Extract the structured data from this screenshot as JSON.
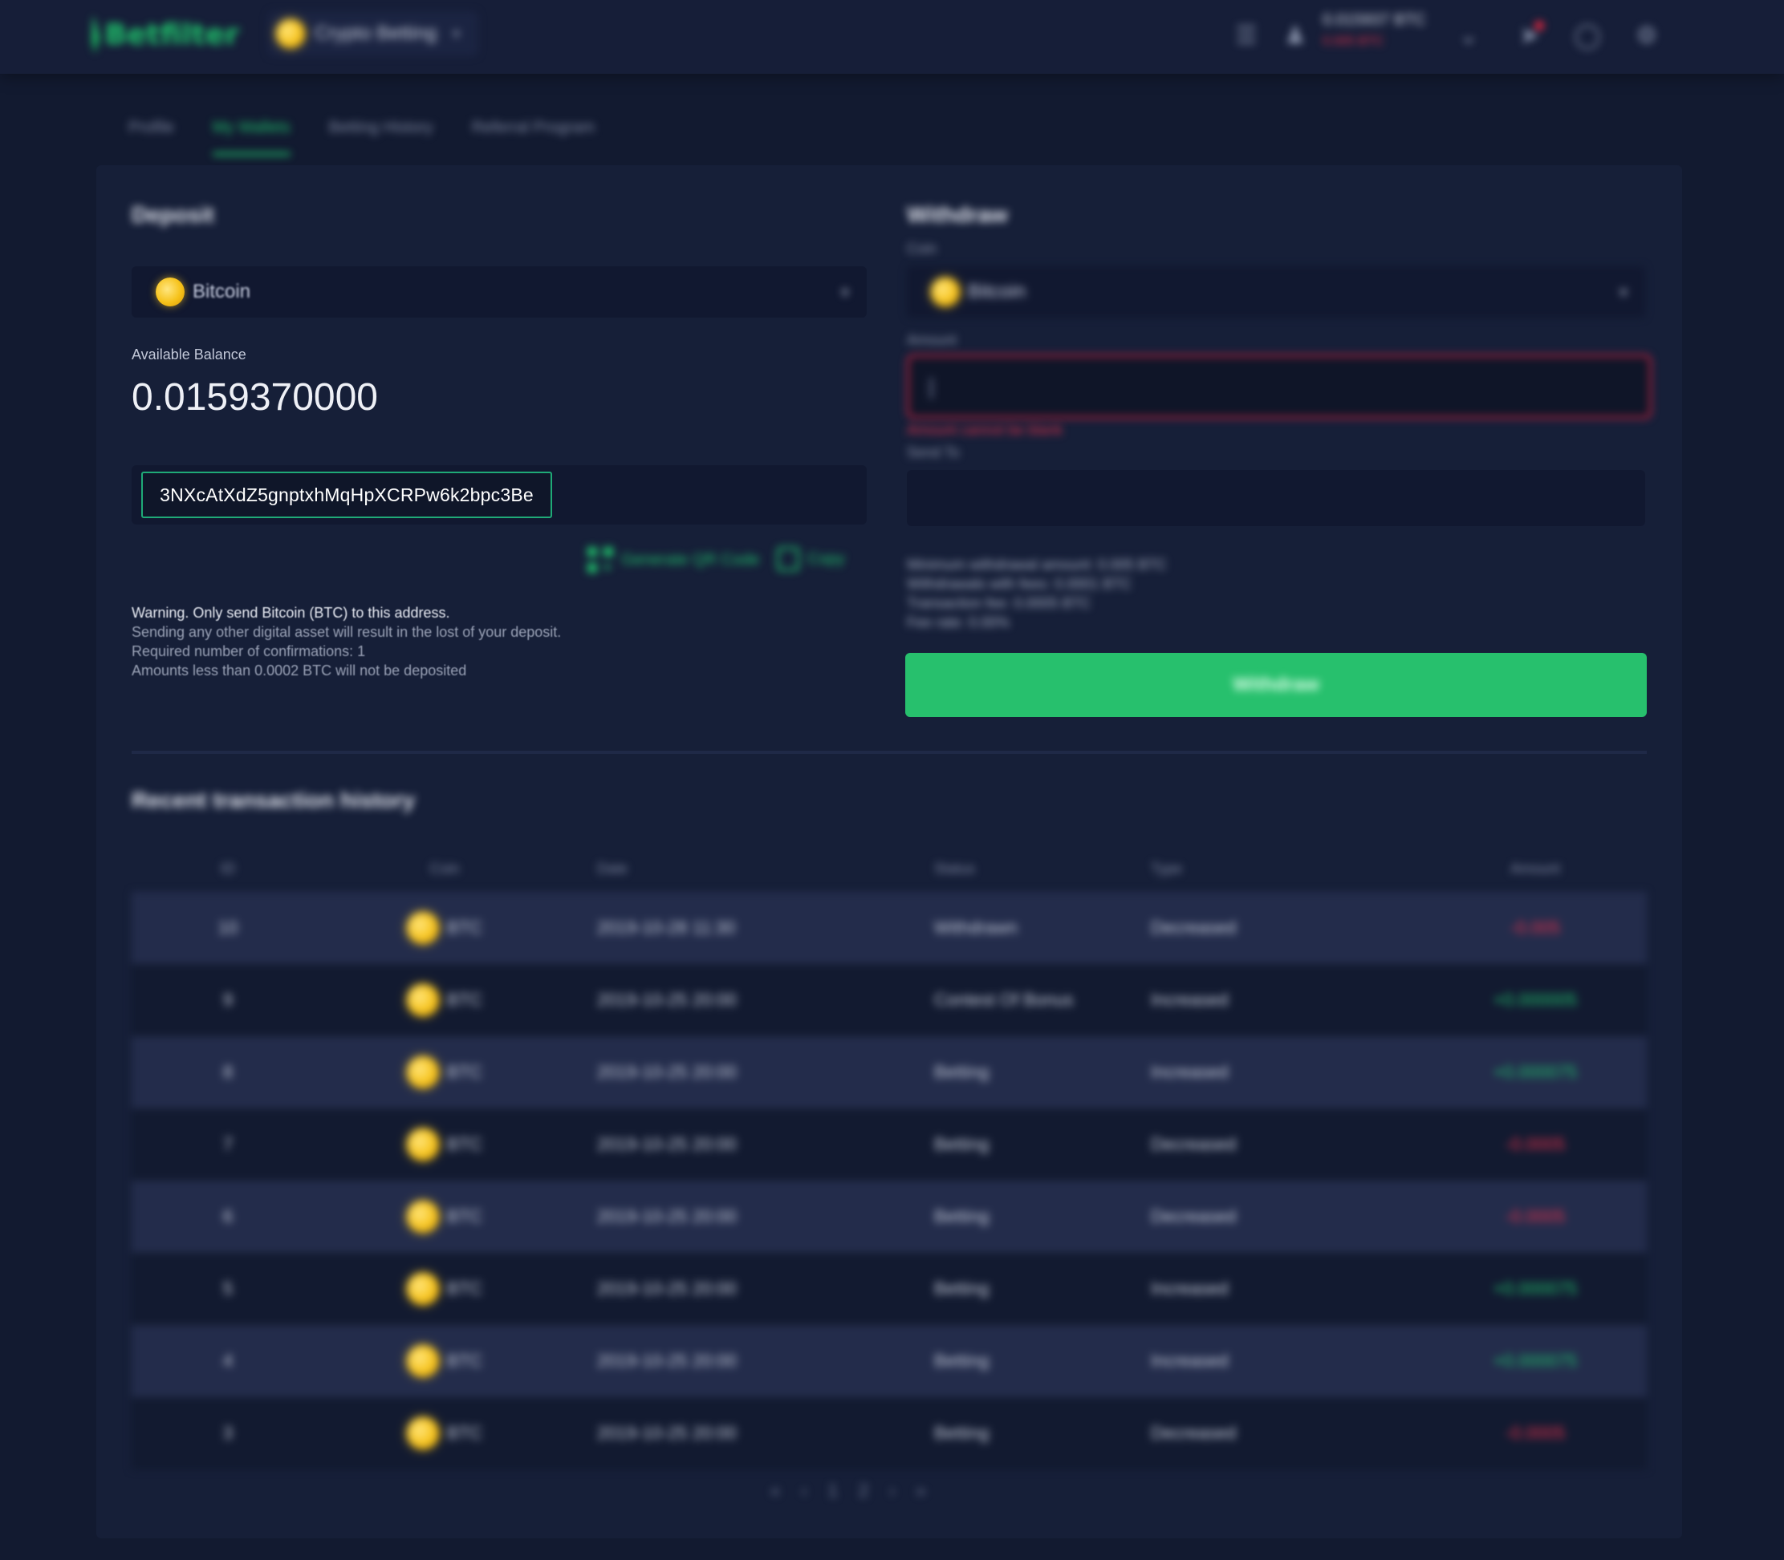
{
  "header": {
    "logo_text": "Betfilter",
    "mode_label": "Crypto Betting",
    "balance_primary": "0.015937 BTC",
    "balance_secondary": "0.005 BTC",
    "icons": [
      "menu-icon",
      "user-icon",
      "chevron-down-icon",
      "rocket-icon",
      "info-icon",
      "settings-icon"
    ]
  },
  "tabs": [
    {
      "label": "Profile",
      "active": false
    },
    {
      "label": "My Wallets",
      "active": true
    },
    {
      "label": "Betting History",
      "active": false
    },
    {
      "label": "Referral Program",
      "active": false
    }
  ],
  "deposit": {
    "title": "Deposit",
    "coin_select": "Bitcoin",
    "balance_label": "Available Balance",
    "balance_value": "0.0159370000",
    "address": "3NXcAtXdZ5gnptxhMqHpXCRPw6k2bpc3Be",
    "qr_label": "Generate QR Code",
    "copy_label": "Copy",
    "warnings": [
      "Warning. Only send Bitcoin (BTC) to this address.",
      "Sending any other digital asset will result in the lost of your deposit.",
      "Required number of confirmations: 1",
      "Amounts less than 0.0002 BTC will not be deposited"
    ]
  },
  "withdraw": {
    "title": "Withdraw",
    "coin_label": "Coin",
    "coin_select": "Bitcoin",
    "amount_label": "Amount",
    "amount_value": "",
    "amount_error": "Amount cannot be blank",
    "note_label": "Send To",
    "fees": [
      "Minimum withdrawal amount: 0.005 BTC",
      "Withdrawals with fees: 0.0001 BTC",
      "Transaction fee: 0.0005 BTC",
      "Fee rate: 0.00%"
    ],
    "button_label": "Withdraw"
  },
  "history": {
    "title": "Recent transaction history",
    "columns": [
      "ID",
      "Coin",
      "Date",
      "Status",
      "Type",
      "Amount"
    ],
    "rows": [
      {
        "id": "10",
        "coin": "BTC",
        "date": "2019-10-28 11:30",
        "status": "Withdrawn",
        "type": "Decreased",
        "amount": "-0.005",
        "sign": "neg"
      },
      {
        "id": "9",
        "coin": "BTC",
        "date": "2019-10-25 20:00",
        "status": "Contest Of Bonus",
        "type": "Increased",
        "amount": "+0.000005",
        "sign": "pos"
      },
      {
        "id": "8",
        "coin": "BTC",
        "date": "2019-10-25 20:00",
        "status": "Betting",
        "type": "Increased",
        "amount": "+0.000075",
        "sign": "pos"
      },
      {
        "id": "7",
        "coin": "BTC",
        "date": "2019-10-25 20:00",
        "status": "Betting",
        "type": "Decreased",
        "amount": "-0.0005",
        "sign": "neg"
      },
      {
        "id": "6",
        "coin": "BTC",
        "date": "2019-10-25 20:00",
        "status": "Betting",
        "type": "Decreased",
        "amount": "-0.0005",
        "sign": "neg"
      },
      {
        "id": "5",
        "coin": "BTC",
        "date": "2019-10-25 20:00",
        "status": "Betting",
        "type": "Increased",
        "amount": "+0.000075",
        "sign": "pos"
      },
      {
        "id": "4",
        "coin": "BTC",
        "date": "2019-10-25 20:00",
        "status": "Betting",
        "type": "Increased",
        "amount": "+0.000075",
        "sign": "pos"
      },
      {
        "id": "3",
        "coin": "BTC",
        "date": "2019-10-25 20:00",
        "status": "Betting",
        "type": "Decreased",
        "amount": "-0.0005",
        "sign": "neg"
      }
    ]
  },
  "pager": [
    "«",
    "‹",
    "1",
    "2",
    "›",
    "»"
  ]
}
